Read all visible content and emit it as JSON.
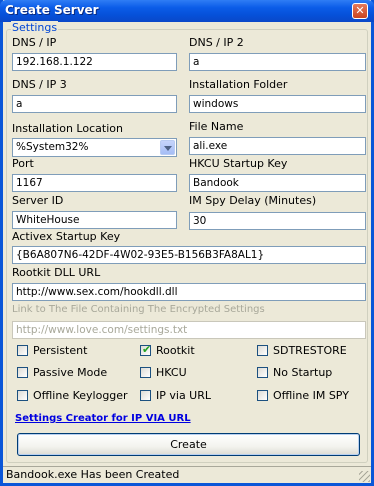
{
  "window": {
    "title": "Create Server",
    "close_glyph": "✕"
  },
  "group": {
    "label": "Settings"
  },
  "fields": {
    "dns_ip": {
      "label": "DNS / IP",
      "value": "192.168.1.122"
    },
    "dns_ip_2": {
      "label": "DNS / IP 2",
      "value": "a"
    },
    "dns_ip_3": {
      "label": "DNS / IP 3",
      "value": "a"
    },
    "install_folder": {
      "label": "Installation Folder",
      "value": "windows"
    },
    "install_location": {
      "label": "Installation Location",
      "value": "%System32%"
    },
    "file_name": {
      "label": "File Name",
      "value": "ali.exe"
    },
    "port": {
      "label": "Port",
      "value": "1167"
    },
    "hkcu_key": {
      "label": "HKCU Startup Key",
      "value": "Bandook"
    },
    "server_id": {
      "label": "Server ID",
      "value": "WhiteHouse"
    },
    "im_spy_delay": {
      "label": "IM Spy Delay (Minutes)",
      "value": "30"
    },
    "activex_key": {
      "label": "Activex Startup Key",
      "value": "{B6A807N6-42DF-4W02-93E5-B156B3FA8AL1}"
    },
    "rootkit_url": {
      "label": "Rootkit DLL URL",
      "value": "http://www.sex.com/hookdll.dll"
    },
    "settings_link": {
      "label": "Link to The File Containing The Encrypted Settings",
      "value": "http://www.love.com/settings.txt"
    }
  },
  "checkboxes": [
    {
      "label": "Persistent",
      "checked": false
    },
    {
      "label": "Rootkit",
      "checked": true
    },
    {
      "label": "SDTRESTORE",
      "checked": false
    },
    {
      "label": "Passive Mode",
      "checked": false
    },
    {
      "label": "HKCU",
      "checked": false
    },
    {
      "label": "No Startup",
      "checked": false
    },
    {
      "label": "Offline Keylogger",
      "checked": false
    },
    {
      "label": "IP via URL",
      "checked": false
    },
    {
      "label": "Offline IM SPY",
      "checked": false
    }
  ],
  "checkmark_glyph": "✔",
  "link": {
    "text": "Settings Creator for IP VIA URL"
  },
  "buttons": {
    "create_label": "Create"
  },
  "status": {
    "text": "Bandook.exe Has been Created"
  },
  "colors": {
    "title_bar": "#0650d8",
    "group_label": "#0046d5",
    "link": "#0000e0",
    "check": "#21a121"
  }
}
